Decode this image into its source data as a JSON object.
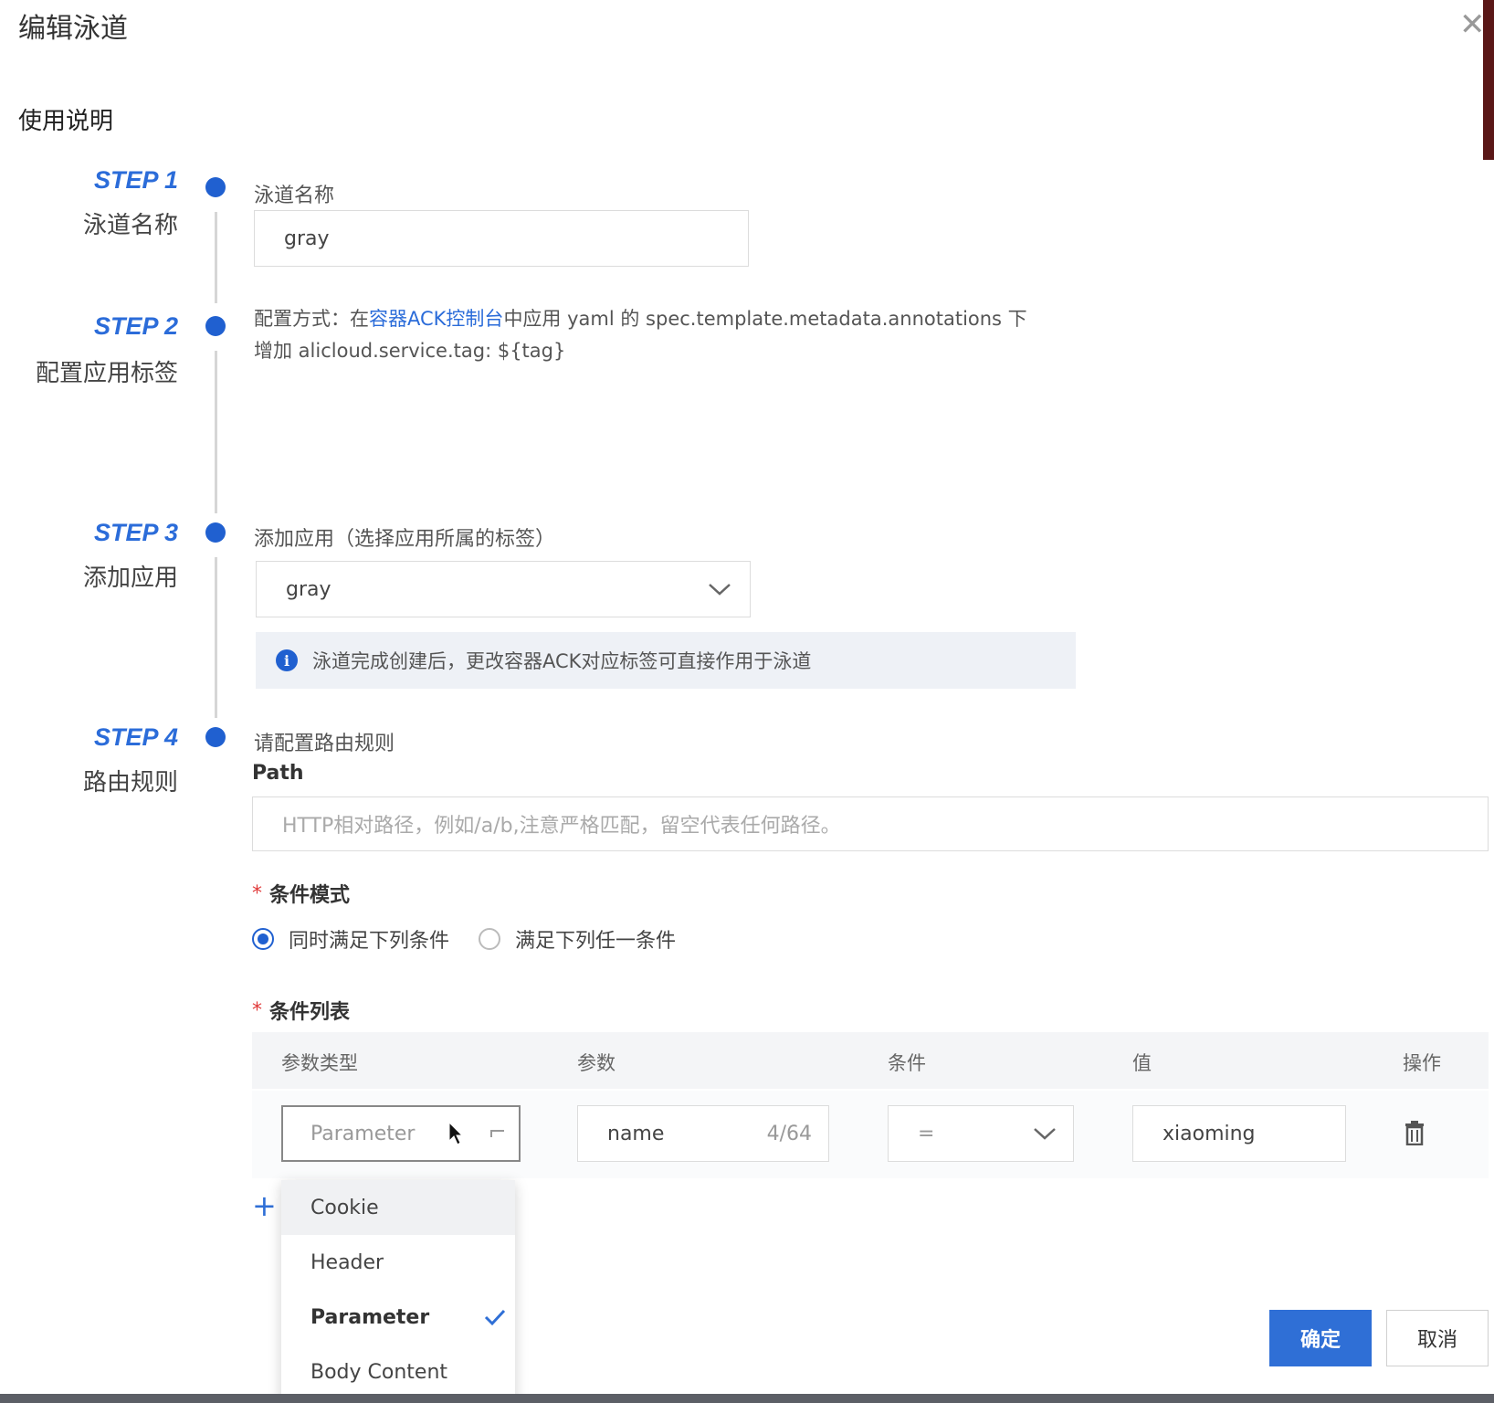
{
  "dialog": {
    "title": "编辑泳道",
    "close_glyph": "✕",
    "section_title": "使用说明"
  },
  "steps": [
    {
      "label": "STEP 1",
      "sub": "泳道名称"
    },
    {
      "label": "STEP 2",
      "sub": "配置应用标签"
    },
    {
      "label": "STEP 3",
      "sub": "添加应用"
    },
    {
      "label": "STEP 4",
      "sub": "路由规则"
    }
  ],
  "step1": {
    "field_label": "泳道名称",
    "value": "gray"
  },
  "step2": {
    "prefix": "配置方式：在",
    "link": "容器ACK控制台",
    "suffix": "中应用 yaml 的 spec.template.metadata.annotations 下",
    "line2": "增加 alicloud.service.tag: ${tag}"
  },
  "step3": {
    "field_label": "添加应用（选择应用所属的标签）",
    "selected": "gray",
    "notice": "泳道完成创建后，更改容器ACK对应标签可直接作用于泳道"
  },
  "step4": {
    "hint": "请配置路由规则",
    "path_label": "Path",
    "path_placeholder": "HTTP相对路径，例如/a/b,注意严格匹配，留空代表任何路径。",
    "mode_label": "条件模式",
    "mode_options": [
      "同时满足下列条件",
      "满足下列任一条件"
    ],
    "list_label": "条件列表",
    "columns": [
      "参数类型",
      "参数",
      "条件",
      "值",
      "操作"
    ],
    "row": {
      "param_type_placeholder": "Parameter",
      "param": "name",
      "param_count": "4/64",
      "condition": "=",
      "value": "xiaoming"
    },
    "dropdown_options": [
      "Cookie",
      "Header",
      "Parameter",
      "Body Content"
    ],
    "dropdown_selected": "Parameter"
  },
  "footer": {
    "ok": "确定",
    "cancel": "取消"
  },
  "colors": {
    "primary": "#2f6fd6",
    "step": "#2b6cd9",
    "required": "#e03a3a"
  }
}
